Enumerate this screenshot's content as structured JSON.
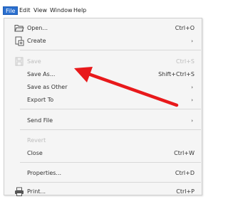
{
  "menubar": {
    "items": [
      "File",
      "Edit",
      "View",
      "Window",
      "Help"
    ]
  },
  "menu": {
    "open": {
      "label": "Open...",
      "shortcut": "Ctrl+O"
    },
    "create": {
      "label": "Create",
      "arrow": "›"
    },
    "save": {
      "label": "Save",
      "shortcut": "Ctrl+S"
    },
    "save_as": {
      "label": "Save As...",
      "shortcut": "Shift+Ctrl+S"
    },
    "save_as_other": {
      "label": "Save as Other",
      "arrow": "›"
    },
    "export_to": {
      "label": "Export To",
      "arrow": "›"
    },
    "send_file": {
      "label": "Send File",
      "arrow": "›"
    },
    "revert": {
      "label": "Revert"
    },
    "close": {
      "label": "Close",
      "shortcut": "Ctrl+W"
    },
    "properties": {
      "label": "Properties...",
      "shortcut": "Ctrl+D"
    },
    "print": {
      "label": "Print...",
      "shortcut": "Ctrl+P"
    }
  },
  "colors": {
    "active_menu_bg": "#2a6fcf",
    "annotation_arrow": "#e8191b",
    "disabled_text": "#bdbdbd"
  },
  "icons": {
    "open": "folder-open-icon",
    "create": "create-pdf-icon",
    "save": "save-disk-icon",
    "print": "printer-icon"
  }
}
